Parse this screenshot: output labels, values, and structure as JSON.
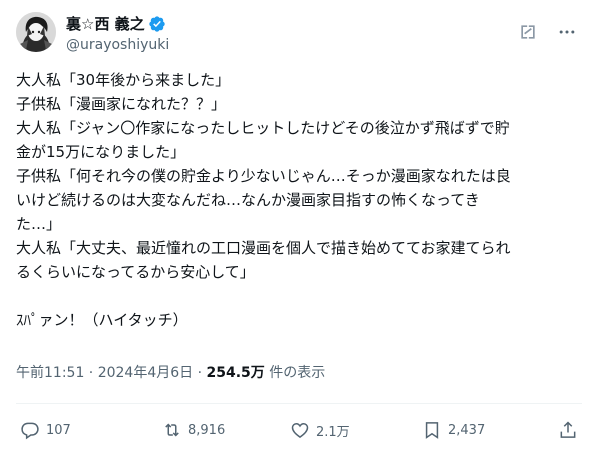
{
  "author": {
    "display_name": "裏☆西 義之",
    "handle": "@urayoshiyuki",
    "verified_badge_color": "#1d9bf0"
  },
  "header_icons": [
    "grok-icon",
    "more-options-icon"
  ],
  "tweet": {
    "lines": [
      "大人私「30年後から来ました」",
      "子供私「漫画家になれた？？」",
      "大人私「ジャン〇作家になったしヒットしたけどその後泣かず飛ばずで貯",
      "金が15万になりました」",
      "子供私「何それ今の僕の貯金より少ないじゃん…そっか漫画家なれたは良",
      "いけど続けるのは大変なんだね…なんか漫画家目指すの怖くなってき",
      "た…」",
      "大人私「大丈夫、最近憧れの工口漫画を個人で描き始めててお家建てられ",
      "るくらいになってるから安心して」",
      "",
      "ｽﾊﾟァン！（ハイタッチ）"
    ],
    "timestamp": "午前11:51 · 2024年4月6日 · ",
    "views_count": "254.5万",
    "views_label": " 件の表示"
  },
  "actions": {
    "replies": "107",
    "reposts": "8,916",
    "likes": "2.1万",
    "bookmarks": "2,437"
  },
  "colors": {
    "text": "#0f1419",
    "secondary": "#536471",
    "divider": "#eff3f4"
  }
}
